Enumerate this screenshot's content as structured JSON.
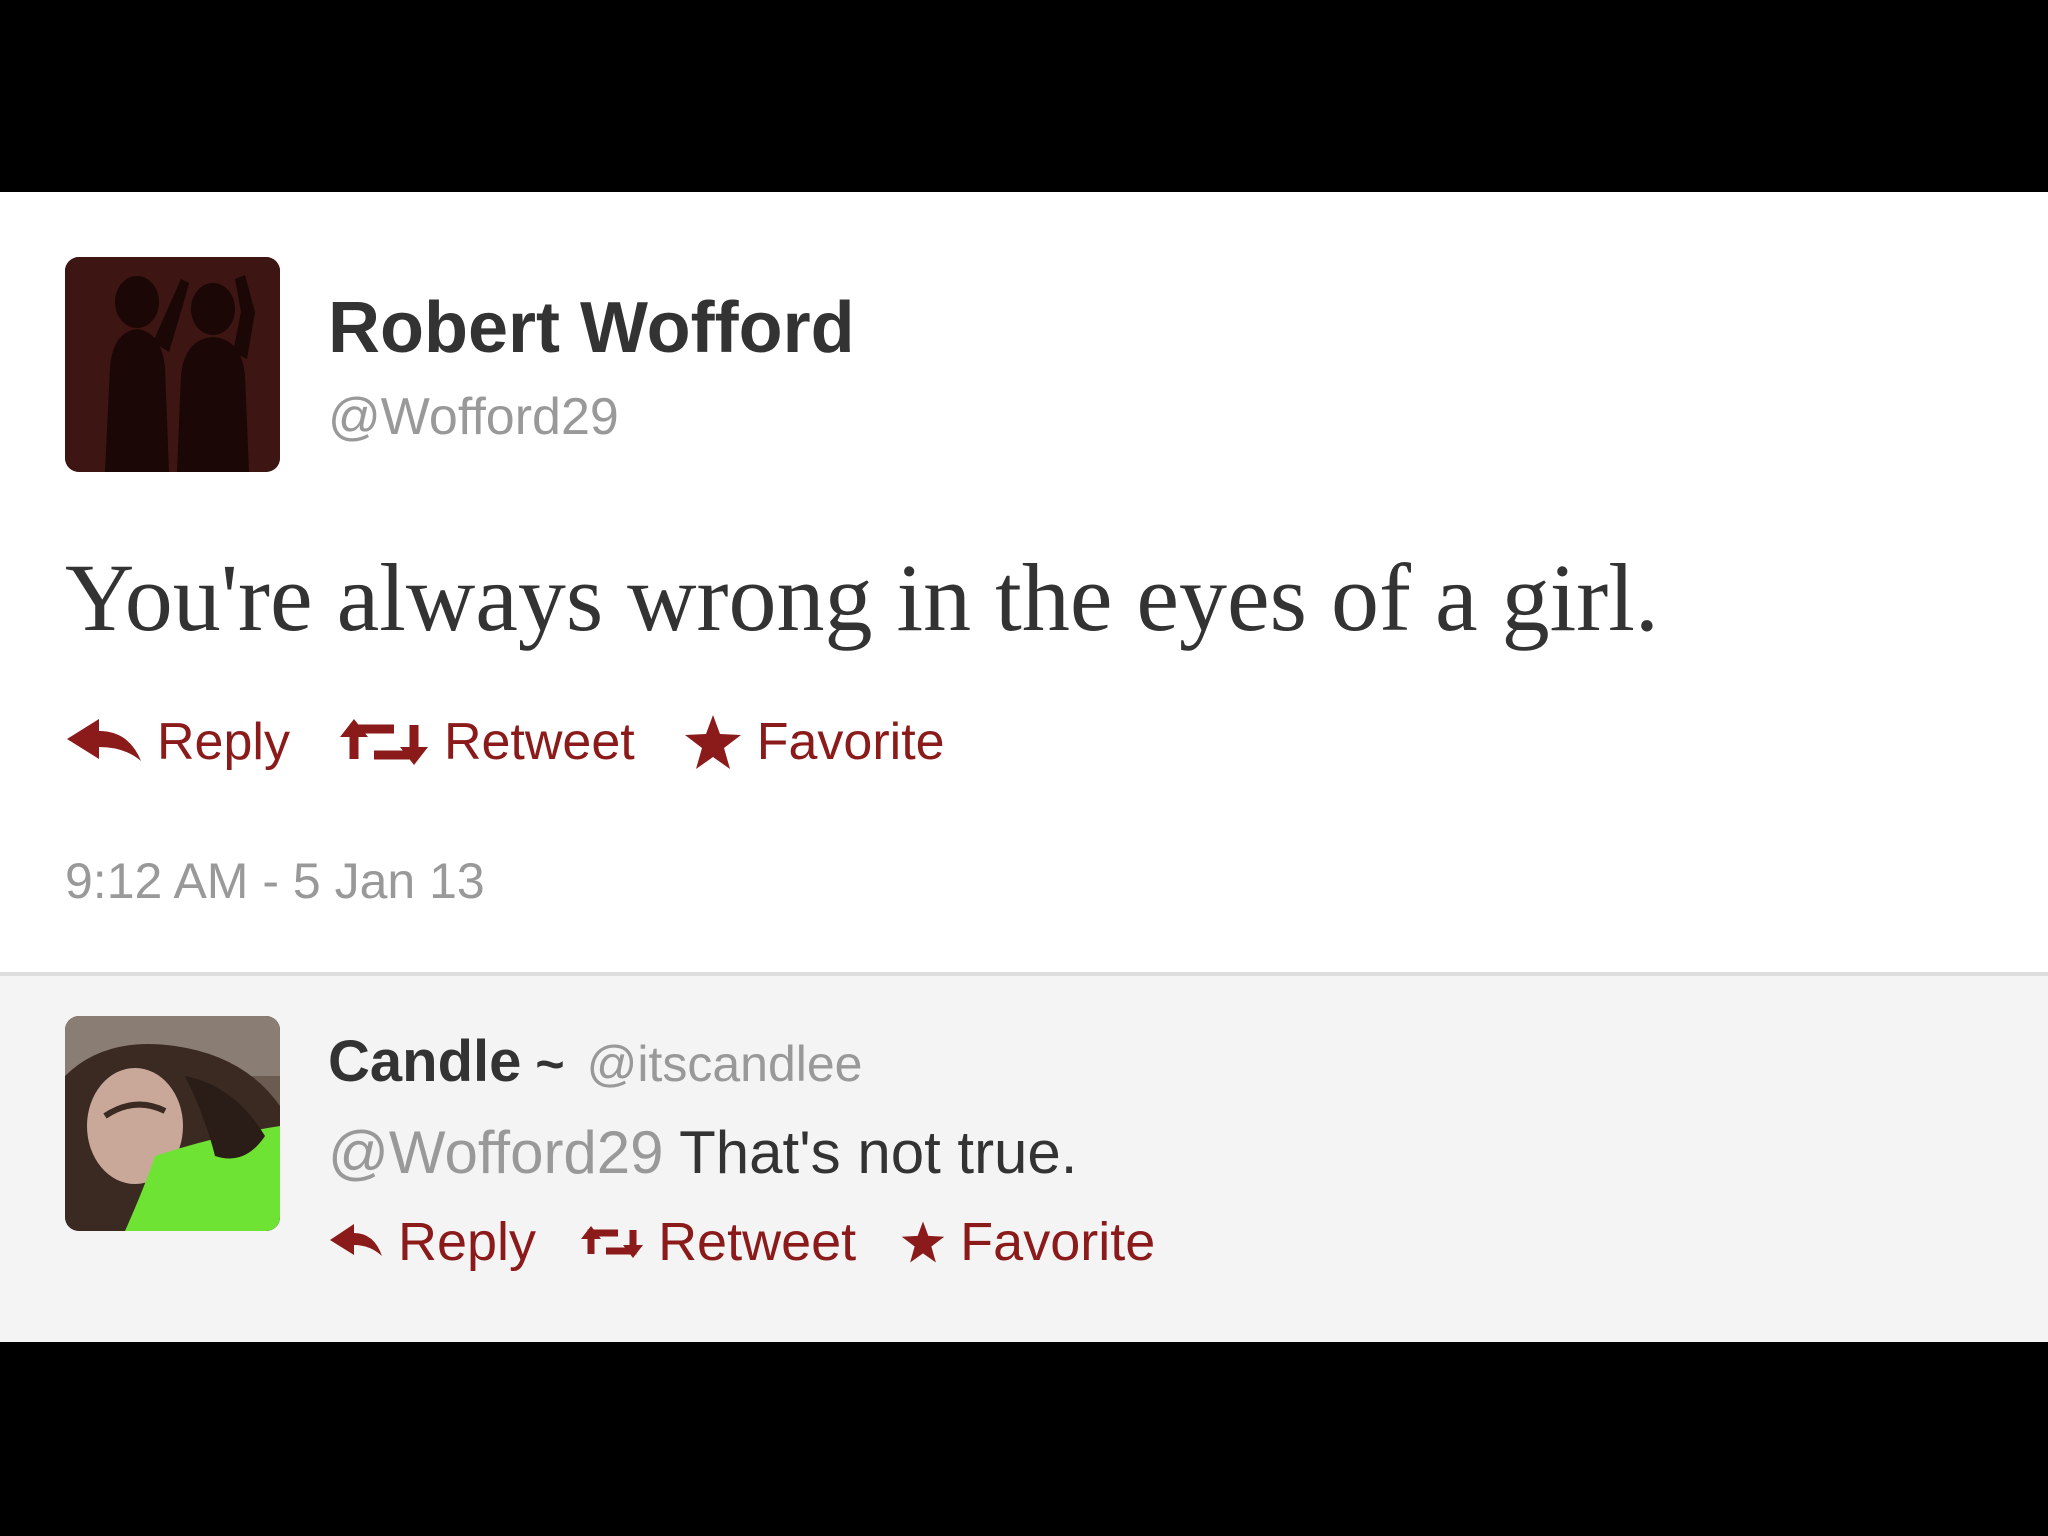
{
  "main_tweet": {
    "name": "Robert Wofford",
    "handle": "@Wofford29",
    "text": "You're always wrong in the eyes of a girl.",
    "actions": {
      "reply": "Reply",
      "retweet": "Retweet",
      "favorite": "Favorite"
    },
    "timestamp": "9:12 AM - 5 Jan 13"
  },
  "reply_tweet": {
    "name": "Candle",
    "separator": "~",
    "handle": "@itscandlee",
    "mention": "@Wofford29",
    "text": "That's not true.",
    "actions": {
      "reply": "Reply",
      "retweet": "Retweet",
      "favorite": "Favorite"
    }
  },
  "colors": {
    "action": "#8b1a1a",
    "muted": "#999999",
    "text": "#333333",
    "reply_background": "#f4f4f4"
  },
  "icons": {
    "reply": "reply-arrow-icon",
    "retweet": "retweet-icon",
    "favorite": "star-icon"
  }
}
